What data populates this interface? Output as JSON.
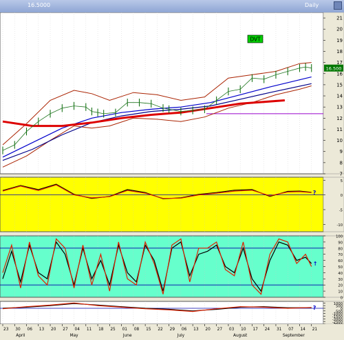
{
  "window": {
    "left_label": "16.5000",
    "right_label": "Daily"
  },
  "chart_data": [
    {
      "type": "line",
      "panel": "price",
      "title": "DVT",
      "last_price_label": "16.500",
      "ylim": [
        7,
        21.5
      ],
      "yticks": [
        "7",
        "8",
        "9",
        "10",
        "11",
        "12",
        "13",
        "14",
        "15",
        "16",
        "17",
        "18",
        "19",
        "20",
        "21"
      ],
      "ytick_values": [
        7,
        8,
        9,
        10,
        11,
        12,
        13,
        14,
        15,
        16,
        17,
        18,
        19,
        20,
        21
      ],
      "x_index_range": [
        0,
        108
      ],
      "price_series": {
        "x": [
          0,
          4,
          8,
          12,
          16,
          20,
          24,
          28,
          30,
          32,
          34,
          38,
          42,
          46,
          50,
          54,
          56,
          60,
          64,
          68,
          72,
          76,
          80,
          84,
          88,
          92,
          96,
          100,
          102,
          104
        ],
        "y": [
          9.1,
          9.6,
          10.8,
          11.7,
          12.4,
          12.9,
          13.1,
          13.0,
          12.6,
          12.5,
          12.4,
          12.5,
          13.4,
          13.4,
          13.3,
          12.9,
          12.8,
          12.6,
          12.7,
          12.8,
          13.6,
          14.4,
          14.6,
          15.6,
          15.5,
          15.9,
          16.2,
          16.5,
          16.6,
          16.5
        ]
      },
      "bands": {
        "x": [
          0,
          8,
          16,
          24,
          30,
          36,
          44,
          52,
          60,
          68,
          76,
          84,
          92,
          100,
          104
        ],
        "upper": [
          9.6,
          11.5,
          13.6,
          14.5,
          14.2,
          13.6,
          14.3,
          14.1,
          13.6,
          13.9,
          15.6,
          15.9,
          16.2,
          16.9,
          17.0
        ],
        "lower": [
          7.6,
          8.6,
          10.0,
          11.3,
          11.1,
          11.3,
          12.0,
          11.9,
          11.7,
          12.1,
          12.9,
          13.4,
          14.1,
          14.6,
          14.9
        ]
      },
      "moving_averages": [
        {
          "color": "#0000cc",
          "x": [
            0,
            10,
            20,
            30,
            40,
            50,
            60,
            70,
            80,
            90,
            104
          ],
          "y": [
            8.5,
            9.8,
            11.1,
            12.0,
            12.5,
            12.8,
            13.0,
            13.4,
            14.1,
            14.8,
            15.7
          ]
        },
        {
          "color": "#000088",
          "x": [
            0,
            10,
            20,
            30,
            40,
            50,
            60,
            70,
            80,
            90,
            104
          ],
          "y": [
            8.2,
            9.2,
            10.5,
            11.6,
            12.2,
            12.6,
            12.8,
            13.1,
            13.7,
            14.3,
            15.1
          ]
        },
        {
          "color": "#dd0000",
          "x": [
            0,
            10,
            20,
            30,
            40,
            50,
            60,
            70,
            80,
            95
          ],
          "y": [
            11.7,
            11.3,
            11.3,
            11.6,
            12.0,
            12.3,
            12.5,
            12.9,
            13.3,
            13.6
          ]
        }
      ],
      "horizontal_line": 12.4
    },
    {
      "type": "line",
      "panel": "oscillator",
      "ylim": [
        -12.5,
        6
      ],
      "yticks": [
        "5",
        "0",
        "-5",
        "-10"
      ],
      "ytick_values": [
        5,
        0,
        -5,
        -10
      ],
      "reference_line": 0,
      "marker": "?",
      "series": [
        {
          "color": "#000000",
          "x": [
            0,
            6,
            12,
            18,
            24,
            30,
            36,
            42,
            48,
            54,
            60,
            66,
            72,
            78,
            84,
            90,
            96,
            100,
            104
          ],
          "y": [
            1.5,
            3.2,
            1.8,
            3.6,
            0.2,
            -1.2,
            -0.5,
            1.8,
            0.8,
            -1.3,
            -1.0,
            0.2,
            0.8,
            1.6,
            1.8,
            -0.5,
            1.2,
            1.3,
            0.9
          ]
        },
        {
          "color": "#dd2200",
          "x": [
            0,
            6,
            12,
            18,
            24,
            30,
            36,
            42,
            48,
            54,
            60,
            66,
            72,
            78,
            84,
            90,
            96,
            100,
            104
          ],
          "y": [
            1.3,
            3.0,
            1.5,
            3.4,
            0.0,
            -1.0,
            -0.6,
            1.5,
            0.6,
            -1.2,
            -1.1,
            0.0,
            0.6,
            1.3,
            1.6,
            -0.3,
            1.0,
            1.1,
            0.8
          ]
        }
      ]
    },
    {
      "type": "line",
      "panel": "stochastic",
      "ylim": [
        0,
        100
      ],
      "yticks": [
        "100",
        "90",
        "80",
        "70",
        "60",
        "50",
        "40",
        "30",
        "20",
        "10",
        "0"
      ],
      "ytick_values": [
        100,
        90,
        80,
        70,
        60,
        50,
        40,
        30,
        20,
        10,
        0
      ],
      "reference_lines": [
        80,
        20
      ],
      "marker": "↑",
      "series": [
        {
          "color": "#000000",
          "x": [
            0,
            3,
            6,
            9,
            12,
            15,
            18,
            21,
            24,
            27,
            30,
            33,
            36,
            39,
            42,
            45,
            48,
            51,
            54,
            57,
            60,
            63,
            66,
            69,
            72,
            75,
            78,
            81,
            84,
            87,
            90,
            93,
            96,
            99,
            102,
            104
          ],
          "y": [
            30,
            75,
            25,
            85,
            40,
            30,
            90,
            70,
            20,
            80,
            30,
            60,
            20,
            85,
            40,
            25,
            85,
            60,
            10,
            80,
            90,
            35,
            70,
            75,
            85,
            50,
            40,
            80,
            30,
            10,
            60,
            90,
            85,
            60,
            65,
            55
          ]
        },
        {
          "color": "#dd2200",
          "x": [
            0,
            3,
            6,
            9,
            12,
            15,
            18,
            21,
            24,
            27,
            30,
            33,
            36,
            39,
            42,
            45,
            48,
            51,
            54,
            57,
            60,
            63,
            66,
            69,
            72,
            75,
            78,
            81,
            84,
            87,
            90,
            93,
            96,
            99,
            102,
            104
          ],
          "y": [
            40,
            85,
            15,
            90,
            35,
            20,
            95,
            80,
            15,
            85,
            20,
            70,
            10,
            90,
            30,
            20,
            90,
            55,
            5,
            85,
            95,
            25,
            80,
            80,
            90,
            45,
            35,
            90,
            20,
            5,
            70,
            95,
            90,
            55,
            70,
            50
          ]
        }
      ]
    },
    {
      "type": "line",
      "panel": "volume_oscillator",
      "ylim": [
        -3000,
        1300
      ],
      "yticks": [
        "1000",
        "500",
        "0",
        "-500",
        "-1000",
        "-1500",
        "-2000",
        "-2500",
        "-3000"
      ],
      "ytick_values": [
        1000,
        500,
        0,
        -500,
        -1000,
        -1500,
        -2000,
        -2500,
        -3000
      ],
      "reference_line": 0,
      "marker": "?",
      "series": [
        {
          "color": "#000000",
          "x": [
            0,
            8,
            16,
            24,
            32,
            40,
            48,
            56,
            64,
            72,
            80,
            88,
            96,
            104
          ],
          "y": [
            0,
            200,
            500,
            900,
            600,
            300,
            0,
            -200,
            -500,
            -200,
            200,
            300,
            100,
            100
          ]
        },
        {
          "color": "#dd2200",
          "x": [
            0,
            8,
            16,
            24,
            32,
            40,
            48,
            56,
            64,
            72,
            80,
            88,
            96,
            104
          ],
          "y": [
            -100,
            300,
            600,
            1000,
            500,
            200,
            -100,
            -300,
            -600,
            -100,
            300,
            200,
            0,
            150
          ]
        }
      ]
    }
  ],
  "x_axis": {
    "day_labels": [
      {
        "i": 0,
        "label": "23"
      },
      {
        "i": 4,
        "label": "30"
      },
      {
        "i": 8,
        "label": "06"
      },
      {
        "i": 12,
        "label": "13"
      },
      {
        "i": 16,
        "label": "20"
      },
      {
        "i": 20,
        "label": "27"
      },
      {
        "i": 24,
        "label": "04"
      },
      {
        "i": 28,
        "label": "11"
      },
      {
        "i": 32,
        "label": "18"
      },
      {
        "i": 36,
        "label": "25"
      },
      {
        "i": 40,
        "label": "01"
      },
      {
        "i": 44,
        "label": "08"
      },
      {
        "i": 48,
        "label": "15"
      },
      {
        "i": 52,
        "label": "22"
      },
      {
        "i": 56,
        "label": "29"
      },
      {
        "i": 60,
        "label": "06"
      },
      {
        "i": 64,
        "label": "13"
      },
      {
        "i": 68,
        "label": "20"
      },
      {
        "i": 72,
        "label": "27"
      },
      {
        "i": 76,
        "label": "03"
      },
      {
        "i": 80,
        "label": "10"
      },
      {
        "i": 84,
        "label": "17"
      },
      {
        "i": 88,
        "label": "24"
      },
      {
        "i": 92,
        "label": "31"
      },
      {
        "i": 96,
        "label": "07"
      },
      {
        "i": 100,
        "label": "14"
      },
      {
        "i": 104,
        "label": "21"
      }
    ],
    "month_labels": [
      {
        "i": 6,
        "label": "April"
      },
      {
        "i": 24,
        "label": "May"
      },
      {
        "i": 42,
        "label": "June"
      },
      {
        "i": 60,
        "label": "July"
      },
      {
        "i": 80,
        "label": "August"
      },
      {
        "i": 98,
        "label": "September"
      }
    ]
  }
}
